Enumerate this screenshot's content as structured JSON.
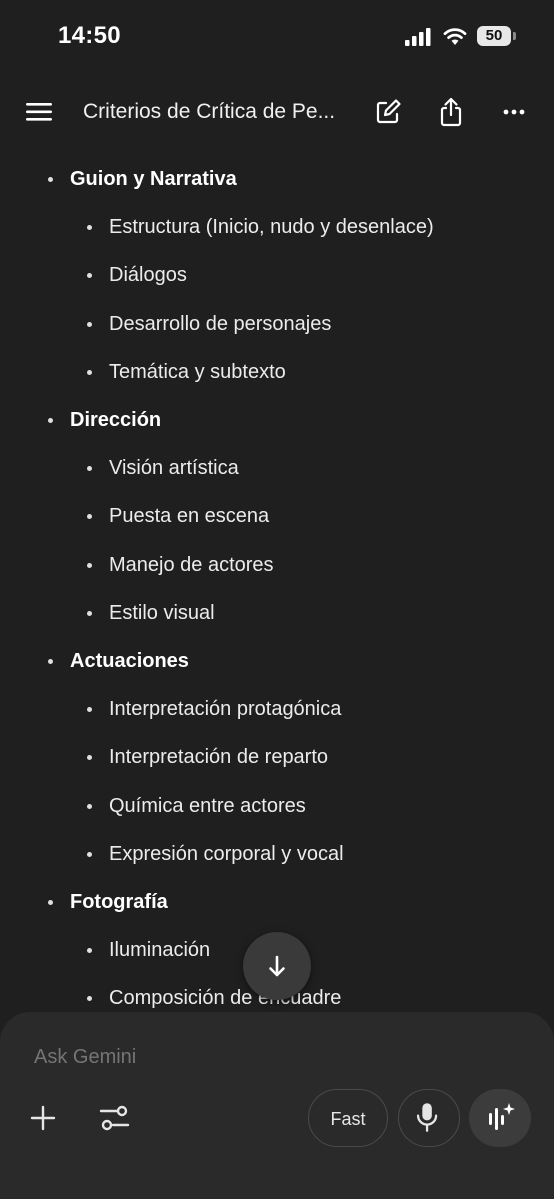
{
  "status_bar": {
    "time": "14:50",
    "battery": "50",
    "icons": [
      "cellular-signal-icon",
      "wifi-icon",
      "battery-icon"
    ]
  },
  "header": {
    "title": "Criterios de Crítica de Pe...",
    "icons": [
      "menu-icon",
      "edit-icon",
      "share-icon",
      "more-icon"
    ]
  },
  "outline": [
    {
      "label": "Guion y Narrativa",
      "children": [
        "Estructura (Inicio, nudo y desenlace)",
        "Diálogos",
        "Desarrollo de personajes",
        "Temática y subtexto"
      ]
    },
    {
      "label": "Dirección",
      "children": [
        "Visión artística",
        "Puesta en escena",
        "Manejo de actores",
        "Estilo visual"
      ]
    },
    {
      "label": "Actuaciones",
      "children": [
        "Interpretación protagónica",
        "Interpretación de reparto",
        "Química entre actores",
        "Expresión corporal y vocal"
      ]
    },
    {
      "label": "Fotografía",
      "children": [
        "Iluminación",
        "Composición de encuadre"
      ]
    }
  ],
  "composer": {
    "placeholder": "Ask Gemini",
    "mode_label": "Fast",
    "icons": [
      "plus-icon",
      "tools-icon",
      "mic-icon",
      "live-icon",
      "arrow-down-icon"
    ]
  },
  "colors": {
    "background": "#1f1f1f",
    "composer_background": "#2a2a2a",
    "text": "#ececec",
    "placeholder": "#9a9a9a"
  }
}
